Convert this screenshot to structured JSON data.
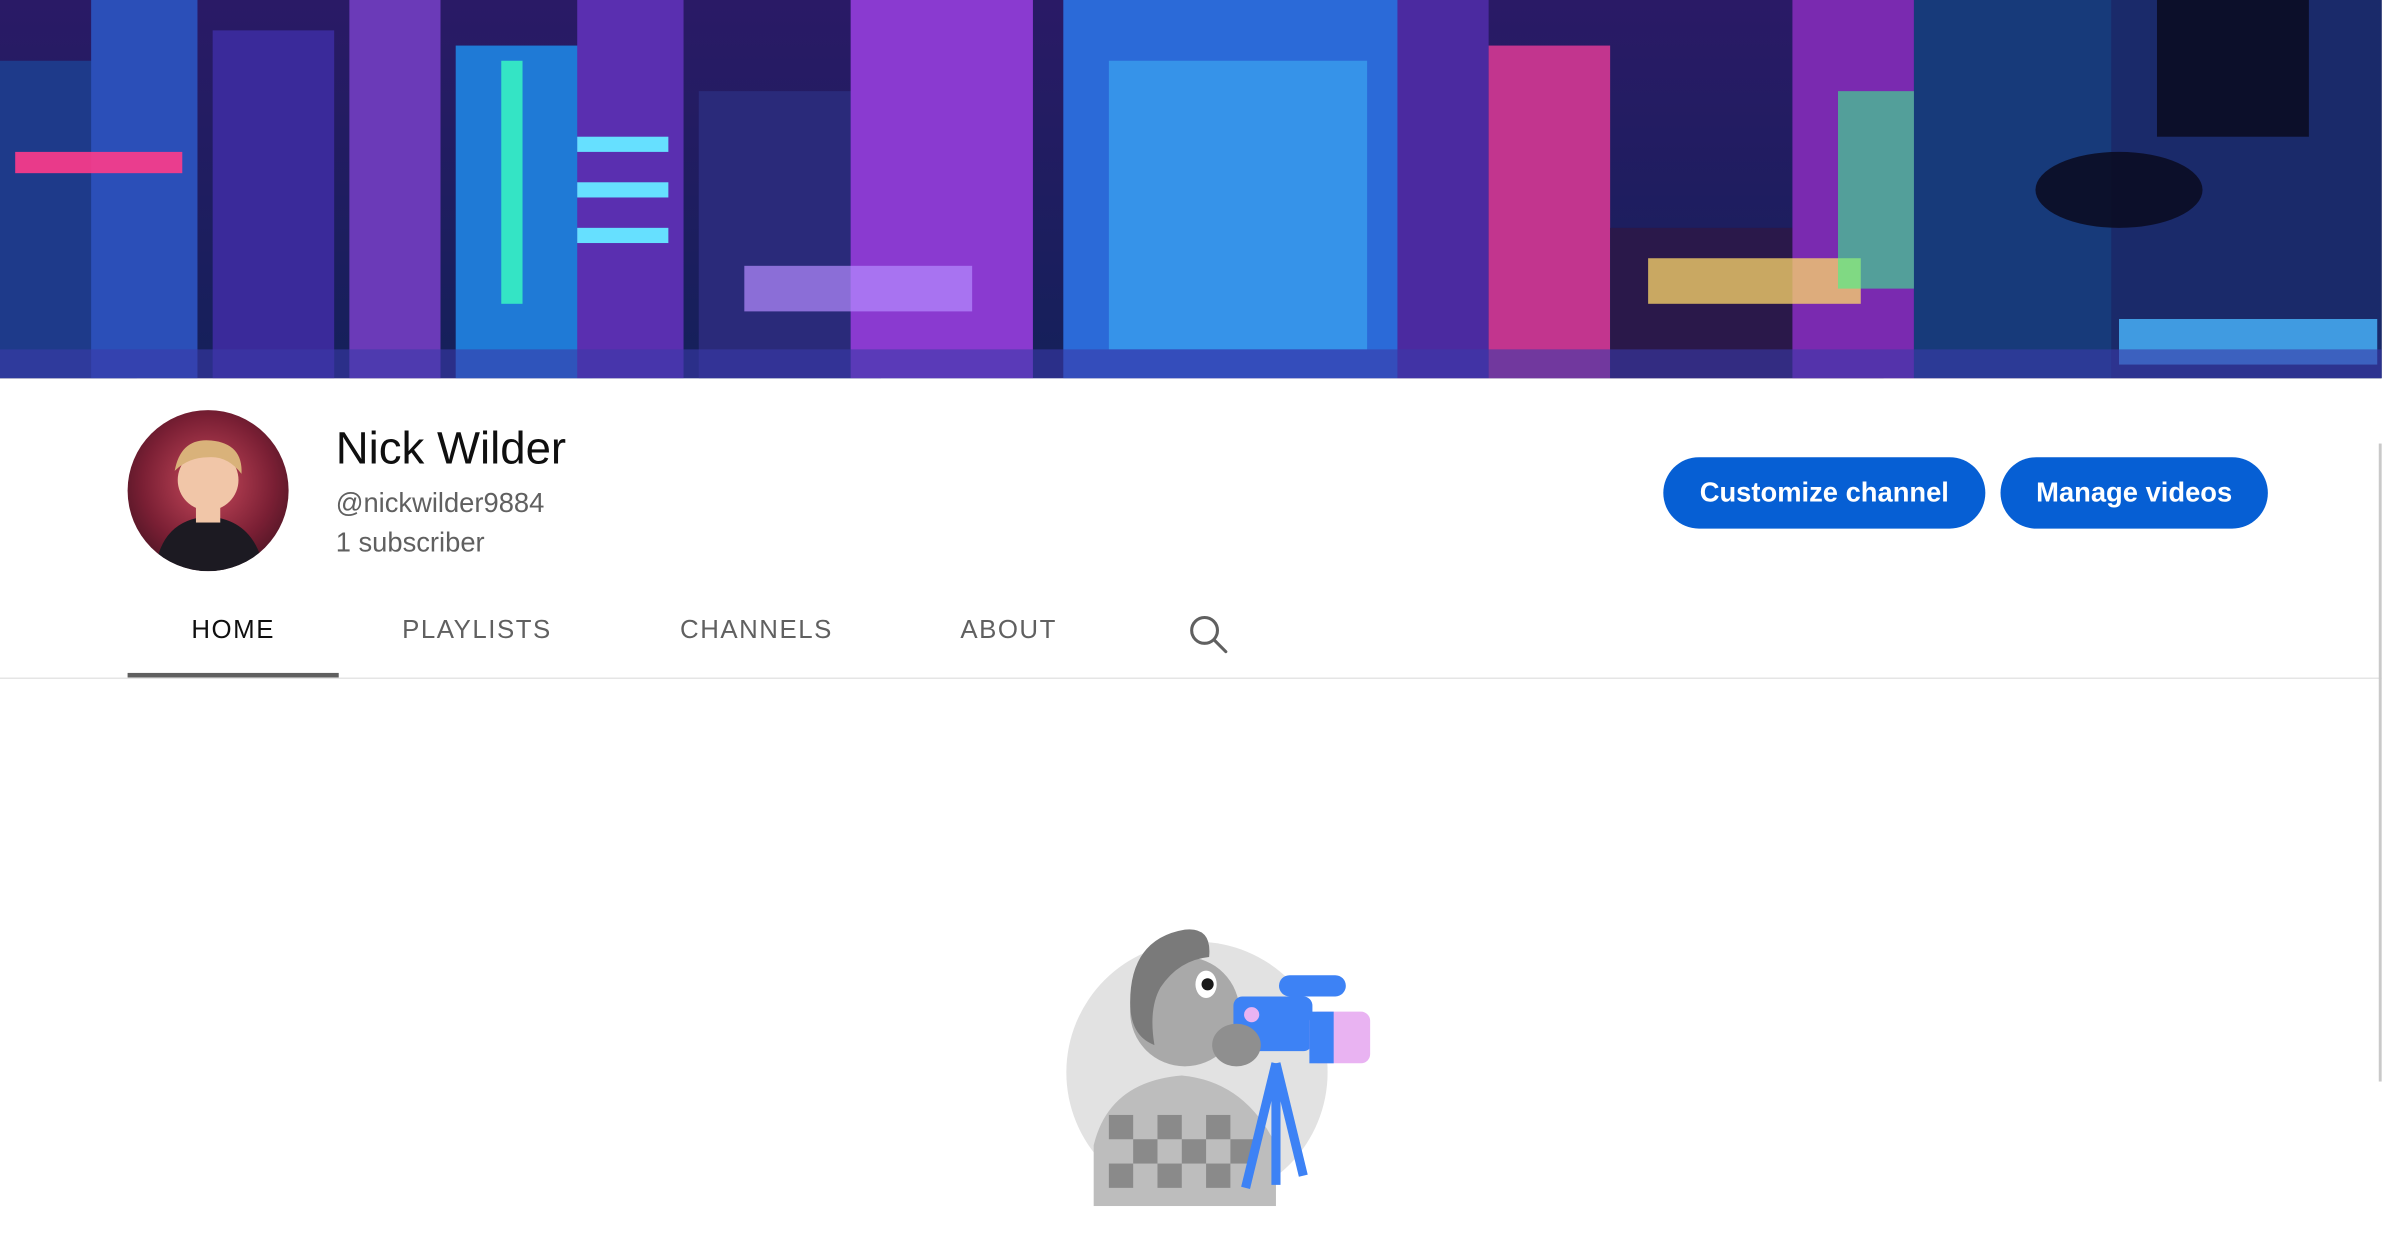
{
  "channel": {
    "name": "Nick Wilder",
    "handle": "@nickwilder9884",
    "subscribers": "1 subscriber"
  },
  "buttons": {
    "customize": "Customize channel",
    "manage": "Manage videos"
  },
  "tabs": [
    {
      "label": "HOME",
      "active": true
    },
    {
      "label": "PLAYLISTS",
      "active": false
    },
    {
      "label": "CHANNELS",
      "active": false
    },
    {
      "label": "ABOUT",
      "active": false
    }
  ],
  "icons": {
    "search": "search-icon"
  },
  "colors": {
    "accent": "#065fd4",
    "text_primary": "#0f0f0f",
    "text_secondary": "#606060"
  }
}
